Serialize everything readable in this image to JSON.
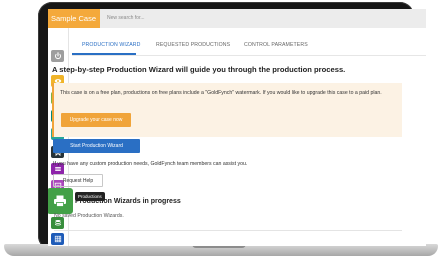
{
  "app": {
    "brand": "Sample Case"
  },
  "search": {
    "placeholder": "New search for..."
  },
  "colors": {
    "brand": "#f4a93b",
    "primary": "#2a6fc4",
    "warning": "#f0a43a"
  },
  "sidebar": {
    "items": [
      {
        "icon": "power-icon",
        "color": "#9e9e9e"
      },
      {
        "icon": "eye-icon",
        "color": "#f0b429"
      },
      {
        "icon": "refresh-icon",
        "color": "#7cb342"
      },
      {
        "icon": "search-icon",
        "color": "#00897b"
      },
      {
        "icon": "users-icon",
        "color": "#26a69a"
      },
      {
        "icon": "bookmark-icon",
        "color": "#263238"
      },
      {
        "icon": "lines-icon",
        "color": "#8e24aa"
      },
      {
        "icon": "list-icon",
        "color": "#ab47bc"
      },
      {
        "icon": "printer-icon",
        "color": "#43a047"
      },
      {
        "icon": "database-icon",
        "color": "#388e3c"
      },
      {
        "icon": "grid-icon",
        "color": "#1e5bb8"
      },
      {
        "icon": "folder-icon",
        "color": "#c62828"
      }
    ],
    "tooltip": "Productions"
  },
  "tabs": [
    {
      "label": "PRODUCTION WIZARD",
      "active": true
    },
    {
      "label": "REQUESTED PRODUCTIONS",
      "active": false
    },
    {
      "label": "CONTROL PARAMETERS",
      "active": false
    }
  ],
  "main": {
    "heading": "A step-by-step Production Wizard will guide you through the production process.",
    "notice": "This case is on a free plan, productions on free plans include a \"GoldFynch\" watermark. If you would like to upgrade this case to a paid plan.",
    "upgrade_label": "Upgrade your case now",
    "start_label": "Start Production Wizard",
    "custom_text": "If you have any custom production needs, GoldFynch team members can assist you.",
    "request_label": "Request Help",
    "wizards_heading": "Production Wizards in progress",
    "no_saved": "No saved Production Wizards."
  }
}
